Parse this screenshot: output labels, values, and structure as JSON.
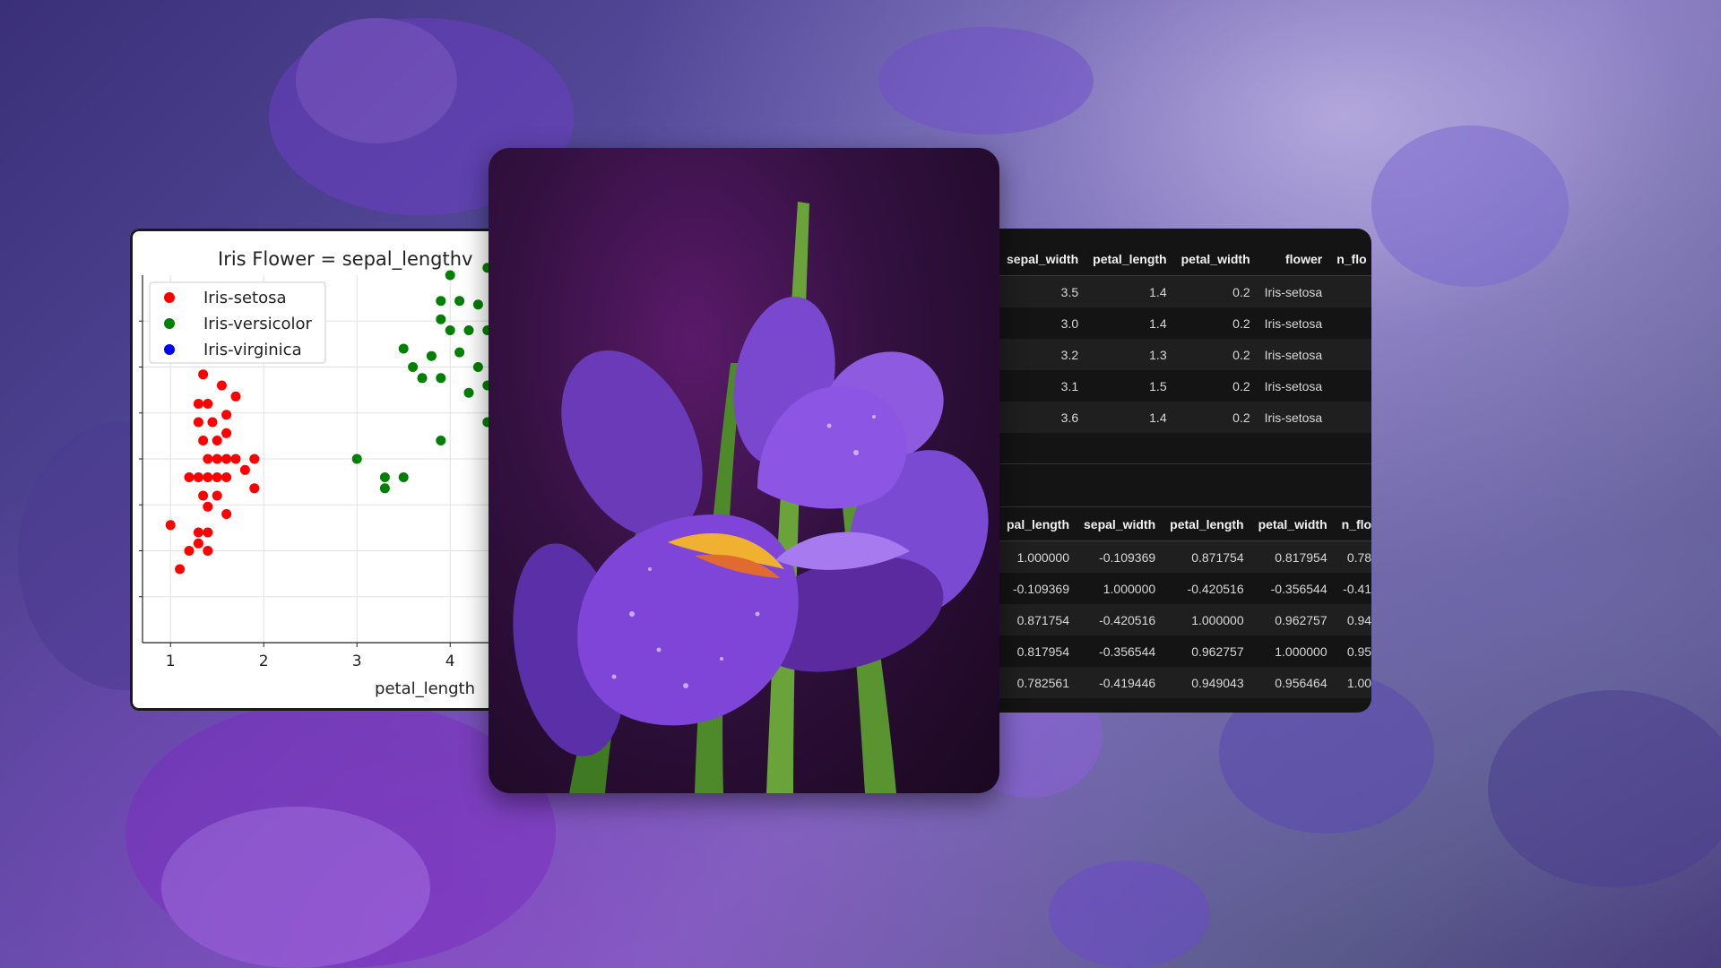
{
  "chart_data": {
    "type": "scatter",
    "title": "Iris Flower = sepal_lengthv",
    "xlabel": "petal_length",
    "ylabel": "",
    "xticks": [
      "1",
      "2",
      "3",
      "4"
    ],
    "xlim": [
      0.7,
      4.7
    ],
    "ylim": [
      0,
      1
    ],
    "legend_position": "top-left",
    "grid": true,
    "series": [
      {
        "name": "Iris-setosa",
        "color": "#ff0000",
        "points": [
          [
            1.2,
            0.82
          ],
          [
            1.35,
            0.73
          ],
          [
            1.5,
            0.8
          ],
          [
            1.7,
            0.8
          ],
          [
            1.3,
            0.65
          ],
          [
            1.4,
            0.65
          ],
          [
            1.55,
            0.7
          ],
          [
            1.3,
            0.6
          ],
          [
            1.45,
            0.6
          ],
          [
            1.6,
            0.62
          ],
          [
            1.7,
            0.67
          ],
          [
            1.35,
            0.55
          ],
          [
            1.5,
            0.55
          ],
          [
            1.6,
            0.57
          ],
          [
            1.4,
            0.5
          ],
          [
            1.5,
            0.5
          ],
          [
            1.6,
            0.5
          ],
          [
            1.7,
            0.5
          ],
          [
            1.9,
            0.5
          ],
          [
            1.2,
            0.45
          ],
          [
            1.3,
            0.45
          ],
          [
            1.4,
            0.45
          ],
          [
            1.5,
            0.45
          ],
          [
            1.6,
            0.45
          ],
          [
            1.8,
            0.47
          ],
          [
            1.35,
            0.4
          ],
          [
            1.5,
            0.4
          ],
          [
            1.9,
            0.42
          ],
          [
            1.4,
            0.37
          ],
          [
            1.6,
            0.35
          ],
          [
            1.3,
            0.3
          ],
          [
            1.4,
            0.3
          ],
          [
            1.0,
            0.32
          ],
          [
            1.3,
            0.27
          ],
          [
            1.4,
            0.25
          ],
          [
            1.2,
            0.25
          ],
          [
            1.1,
            0.2
          ]
        ]
      },
      {
        "name": "Iris-versicolor",
        "color": "#008000",
        "points": [
          [
            4.4,
            1.3
          ],
          [
            4.2,
            1.22
          ],
          [
            4.4,
            1.2
          ],
          [
            4.1,
            1.15
          ],
          [
            4.3,
            1.1
          ],
          [
            4.5,
            1.1
          ],
          [
            4.0,
            1.0
          ],
          [
            4.4,
            1.02
          ],
          [
            4.6,
            1.0
          ],
          [
            3.9,
            0.93
          ],
          [
            4.1,
            0.93
          ],
          [
            4.3,
            0.92
          ],
          [
            4.5,
            0.92
          ],
          [
            3.9,
            0.88
          ],
          [
            4.0,
            0.85
          ],
          [
            4.2,
            0.85
          ],
          [
            4.4,
            0.85
          ],
          [
            4.6,
            0.85
          ],
          [
            3.5,
            0.8
          ],
          [
            3.6,
            0.75
          ],
          [
            3.8,
            0.78
          ],
          [
            4.1,
            0.79
          ],
          [
            4.3,
            0.75
          ],
          [
            4.4,
            0.7
          ],
          [
            3.7,
            0.72
          ],
          [
            3.9,
            0.72
          ],
          [
            4.2,
            0.68
          ],
          [
            4.5,
            0.72
          ],
          [
            4.4,
            0.6
          ],
          [
            3.9,
            0.55
          ],
          [
            3.0,
            0.5
          ],
          [
            3.3,
            0.45
          ],
          [
            3.5,
            0.45
          ],
          [
            3.3,
            0.42
          ]
        ]
      },
      {
        "name": "Iris-virginica",
        "color": "#0000ff",
        "points": [
          [
            4.5,
            0.39
          ]
        ]
      }
    ]
  },
  "df_top": {
    "headers": [
      "sepal_width",
      "petal_length",
      "petal_width",
      "flower",
      "n_flo"
    ],
    "rows": [
      [
        "3.5",
        "1.4",
        "0.2",
        "Iris-setosa",
        ""
      ],
      [
        "3.0",
        "1.4",
        "0.2",
        "Iris-setosa",
        ""
      ],
      [
        "3.2",
        "1.3",
        "0.2",
        "Iris-setosa",
        ""
      ],
      [
        "3.1",
        "1.5",
        "0.2",
        "Iris-setosa",
        ""
      ],
      [
        "3.6",
        "1.4",
        "0.2",
        "Iris-setosa",
        ""
      ]
    ]
  },
  "df_corr": {
    "headers": [
      "pal_length",
      "sepal_width",
      "petal_length",
      "petal_width",
      "n_flo"
    ],
    "rows": [
      [
        "1.000000",
        "-0.109369",
        "0.871754",
        "0.817954",
        "0.78"
      ],
      [
        "-0.109369",
        "1.000000",
        "-0.420516",
        "-0.356544",
        "-0.41"
      ],
      [
        "0.871754",
        "-0.420516",
        "1.000000",
        "0.962757",
        "0.94"
      ],
      [
        "0.817954",
        "-0.356544",
        "0.962757",
        "1.000000",
        "0.95"
      ],
      [
        "0.782561",
        "-0.419446",
        "0.949043",
        "0.956464",
        "1.00"
      ]
    ]
  }
}
